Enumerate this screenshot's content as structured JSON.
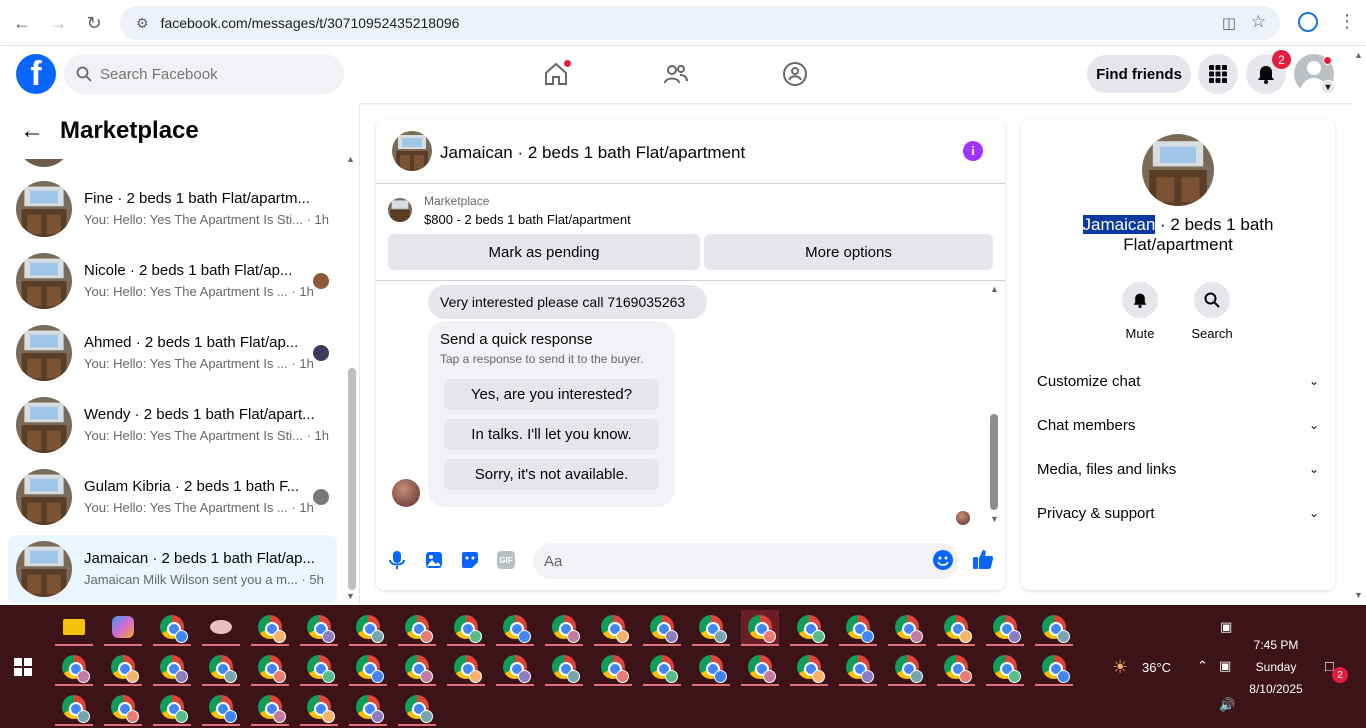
{
  "browser": {
    "url": "facebook.com/messages/t/30710952435218096"
  },
  "header": {
    "search_placeholder": "Search Facebook",
    "find_friends": "Find friends",
    "notifications_count": "2"
  },
  "sidebar": {
    "title": "Marketplace",
    "conversations": [
      {
        "name": "Fine · 2 beds 1 bath Flat/apartm...",
        "preview": "You: Hello: Yes The Apartment Is Sti... · 1h"
      },
      {
        "name": "Nicole · 2 beds 1 bath Flat/ap...",
        "preview": "You: Hello: Yes The Apartment Is ... · 1h"
      },
      {
        "name": "Ahmed · 2 beds 1 bath Flat/ap...",
        "preview": "You: Hello: Yes The Apartment Is ... · 1h"
      },
      {
        "name": "Wendy · 2 beds 1 bath Flat/apart...",
        "preview": "You: Hello: Yes The Apartment Is Sti... · 1h"
      },
      {
        "name": "Gulam Kibria · 2 beds 1 bath F...",
        "preview": "You: Hello: Yes The Apartment Is ... · 1h"
      },
      {
        "name": "Jamaican · 2 beds 1 bath Flat/ap...",
        "preview": "Jamaican Milk Wilson sent you a m... · 5h"
      }
    ]
  },
  "chat": {
    "title": "Jamaican · 2 beds 1 bath Flat/apartment",
    "listing_source": "Marketplace",
    "listing_price": "$800 - 2 beds 1 bath Flat/apartment",
    "mark_pending": "Mark as pending",
    "more_options": "More options",
    "message": "Very interested please call 7169035263",
    "quick_title": "Send a quick response",
    "quick_subtitle": "Tap a response to send it to the buyer.",
    "quick_options": [
      "Yes, are you interested?",
      "In talks. I'll let you know.",
      "Sorry, it's not available."
    ],
    "composer_placeholder": "Aa"
  },
  "details": {
    "title_highlight": "Jamaican",
    "title_rest": " · 2 beds 1 bath Flat/apartment",
    "mute": "Mute",
    "search": "Search",
    "sections": [
      "Customize chat",
      "Chat members",
      "Media, files and links",
      "Privacy & support"
    ]
  },
  "taskbar": {
    "weather": "36°C",
    "time": "7:45 PM",
    "day": "Sunday",
    "date": "8/10/2025",
    "notif_count": "2"
  },
  "colors": {
    "fb_blue": "#0866ff",
    "taskbar_bg": "#3b1318",
    "info_purple": "#a033ff"
  }
}
